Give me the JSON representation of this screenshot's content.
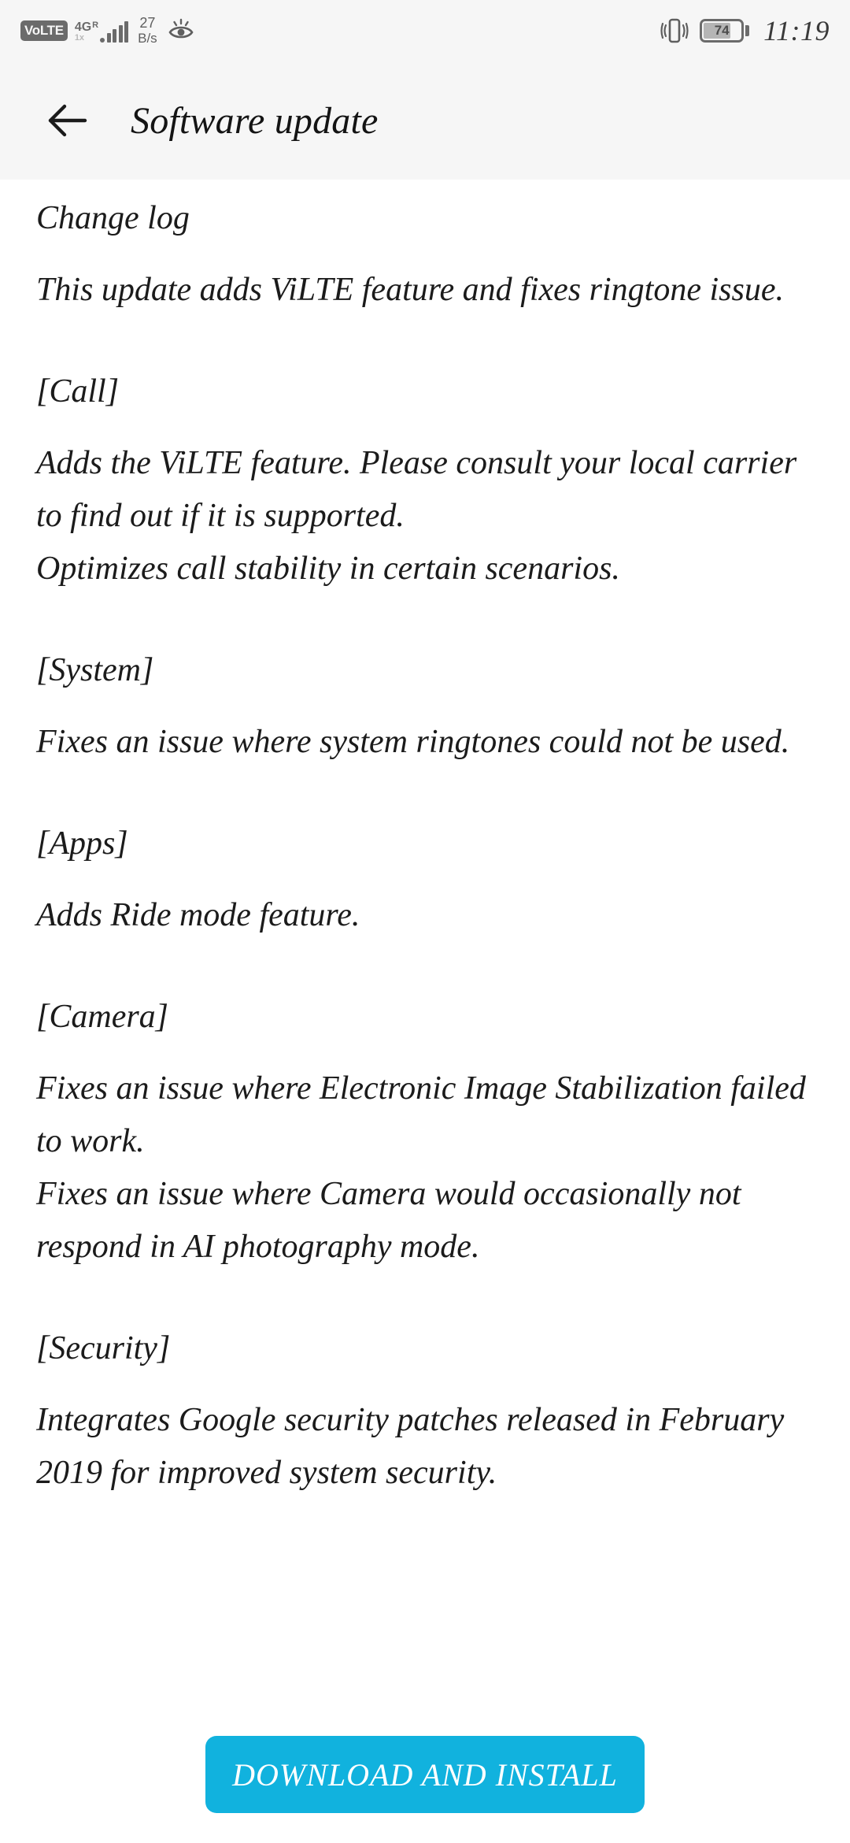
{
  "statusbar": {
    "volte_label": "VoLTE",
    "network_type": "4G",
    "roaming_indicator": "R",
    "network_sub": "1x",
    "net_speed_value": "27",
    "net_speed_unit": "B/s",
    "eye_comfort_icon": "eye-comfort-icon",
    "vibrate_icon": "vibrate-icon",
    "battery_percent": "74",
    "battery_level": 74,
    "time": "11:19"
  },
  "appbar": {
    "back_icon": "back-arrow-icon",
    "title": "Software update"
  },
  "content": {
    "change_log_heading": "Change log",
    "summary": "This update adds ViLTE feature and fixes ringtone issue.",
    "sections": [
      {
        "tag": "[Call]",
        "lines": [
          "Adds the ViLTE feature. Please consult your local carrier to find out if it is supported.",
          "Optimizes call stability in certain scenarios."
        ]
      },
      {
        "tag": "[System]",
        "lines": [
          "Fixes an issue where system ringtones could not be used."
        ]
      },
      {
        "tag": "[Apps]",
        "lines": [
          "Adds Ride mode feature."
        ]
      },
      {
        "tag": "[Camera]",
        "lines": [
          "Fixes an issue where Electronic Image Stabilization failed to work.",
          "Fixes an issue where Camera would occasionally not respond in AI photography mode."
        ]
      },
      {
        "tag": "[Security]",
        "lines": [
          "Integrates Google security patches released in February 2019 for improved system security."
        ]
      }
    ]
  },
  "footer": {
    "download_label": "DOWNLOAD AND INSTALL"
  },
  "colors": {
    "accent": "#11b2de",
    "bar_background": "#f6f6f6",
    "page_background": "#ffffff",
    "text": "#1b1b1b",
    "status_icon": "#6b6b6b"
  }
}
